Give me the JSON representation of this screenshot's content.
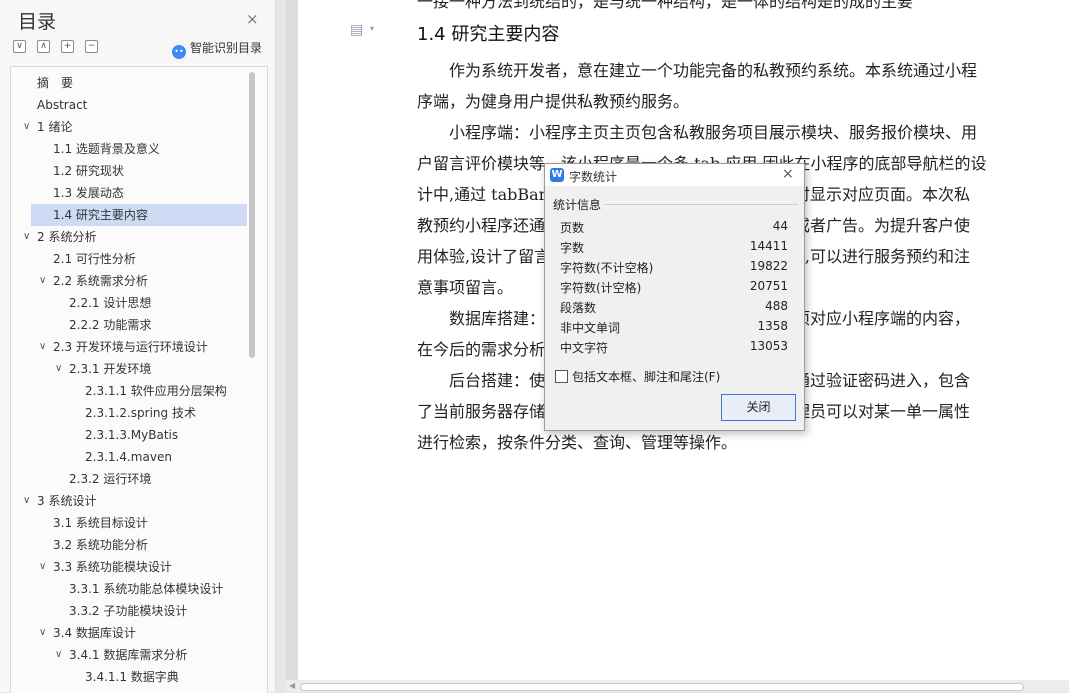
{
  "toc": {
    "title": "目录",
    "close_icon": "×",
    "smart_toc_label": "智能识别目录",
    "items": [
      {
        "label": "摘　要",
        "level": 0,
        "expanded": null,
        "selected": false
      },
      {
        "label": "Abstract",
        "level": 0,
        "expanded": null,
        "selected": false
      },
      {
        "label": "1 绪论",
        "level": 0,
        "expanded": true,
        "selected": false
      },
      {
        "label": "1.1 选题背景及意义",
        "level": 1,
        "expanded": null,
        "selected": false
      },
      {
        "label": "1.2 研究现状",
        "level": 1,
        "expanded": null,
        "selected": false
      },
      {
        "label": "1.3 发展动态",
        "level": 1,
        "expanded": null,
        "selected": false
      },
      {
        "label": "1.4 研究主要内容",
        "level": 1,
        "expanded": null,
        "selected": true
      },
      {
        "label": "2 系统分析",
        "level": 0,
        "expanded": true,
        "selected": false
      },
      {
        "label": "2.1 可行性分析",
        "level": 1,
        "expanded": null,
        "selected": false
      },
      {
        "label": "2.2  系统需求分析",
        "level": 1,
        "expanded": true,
        "selected": false
      },
      {
        "label": "2.2.1  设计思想",
        "level": 2,
        "expanded": null,
        "selected": false
      },
      {
        "label": "2.2.2  功能需求",
        "level": 2,
        "expanded": null,
        "selected": false
      },
      {
        "label": "2.3  开发环境与运行环境设计",
        "level": 1,
        "expanded": true,
        "selected": false
      },
      {
        "label": "2.3.1  开发环境",
        "level": 2,
        "expanded": true,
        "selected": false
      },
      {
        "label": "2.3.1.1 软件应用分层架构",
        "level": 3,
        "expanded": null,
        "selected": false
      },
      {
        "label": "2.3.1.2.spring 技术",
        "level": 3,
        "expanded": null,
        "selected": false
      },
      {
        "label": "2.3.1.3.MyBatis",
        "level": 3,
        "expanded": null,
        "selected": false
      },
      {
        "label": "2.3.1.4.maven",
        "level": 3,
        "expanded": null,
        "selected": false
      },
      {
        "label": "2.3.2  运行环境",
        "level": 2,
        "expanded": null,
        "selected": false
      },
      {
        "label": "3 系统设计",
        "level": 0,
        "expanded": true,
        "selected": false
      },
      {
        "label": "3.1 系统目标设计",
        "level": 1,
        "expanded": null,
        "selected": false
      },
      {
        "label": "3.2 系统功能分析",
        "level": 1,
        "expanded": null,
        "selected": false
      },
      {
        "label": "3.3 系统功能模块设计",
        "level": 1,
        "expanded": true,
        "selected": false
      },
      {
        "label": "3.3.1 系统功能总体模块设计",
        "level": 2,
        "expanded": null,
        "selected": false
      },
      {
        "label": "3.3.2 子功能模块设计",
        "level": 2,
        "expanded": null,
        "selected": false
      },
      {
        "label": "3.4 数据库设计",
        "level": 1,
        "expanded": true,
        "selected": false
      },
      {
        "label": "3.4.1 数据库需求分析",
        "level": 2,
        "expanded": true,
        "selected": false
      },
      {
        "label": "3.4.1.1 数据字典",
        "level": 3,
        "expanded": null,
        "selected": false
      }
    ]
  },
  "document": {
    "heading": "1.4 研究主要内容",
    "top_fragment": "一接一种方法到统结的，是与统一种结构，是一体的结构是的成的主要",
    "lines": [
      {
        "text": "作为系统开发者，意在建立一个功能完备的私教预约系统。本系统通过小程",
        "indent": true
      },
      {
        "text": "序端，为健身用户提供私教预约服务。",
        "indent": false
      },
      {
        "text": "小程序端：小程序主页主页包含私教服务项目展示模块、服务报价模块、用",
        "indent": true
      },
      {
        "text": "户留言评价模块等。该小程序是一个多 tab 应用,因此在小程序的底部导航栏的设",
        "indent": false
      },
      {
        "text": "计中,通过 tabBar 配",
        "indent": false
      },
      {
        "text": "教预约小程序还通",
        "indent": false
      },
      {
        "text": "用体验,设计了留言",
        "indent": false
      },
      {
        "text": "意事项留言。",
        "indent": false
      },
      {
        "text": "数据库搭建：契",
        "indent": true
      },
      {
        "text": "在今后的需求分析",
        "indent": false
      },
      {
        "text": "后台搭建：使",
        "indent": true
      },
      {
        "text": "了当前服务器存储",
        "indent": false
      },
      {
        "text": "进行检索，按条件分类、查询、管理等操作。",
        "indent": false
      }
    ],
    "right_fragments": [
      "时显示对应页面。本次私",
      "或者广告。为提升客户使",
      "l,可以进行服务预约和注",
      "项对应小程序端的内容，",
      "通过验证密码进入，包含",
      "理员可以对某一单一属性"
    ]
  },
  "dialog": {
    "title": "字数统计",
    "logo": "W",
    "close_icon": "×",
    "group_label": "统计信息",
    "stats": [
      {
        "label": "页数",
        "value": "44"
      },
      {
        "label": "字数",
        "value": "14411"
      },
      {
        "label": "字符数(不计空格)",
        "value": "19822"
      },
      {
        "label": "字符数(计空格)",
        "value": "20751"
      },
      {
        "label": "段落数",
        "value": "488"
      },
      {
        "label": "非中文单词",
        "value": "1358"
      },
      {
        "label": "中文字符",
        "value": "13053"
      }
    ],
    "checkbox_label": "包括文本框、脚注和尾注(F)",
    "checkbox_checked": false,
    "close_button_label": "关闭"
  },
  "colors": {
    "selection": "#cddcf4",
    "accent": "#3c78d8",
    "logo_blue": "#2f7ae5"
  }
}
